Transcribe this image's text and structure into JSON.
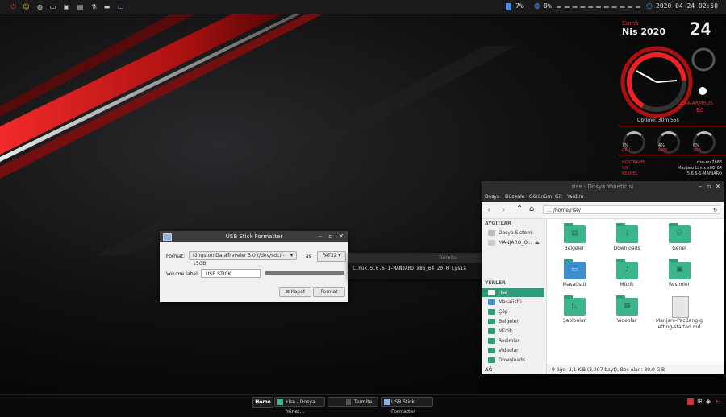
{
  "top_panel": {
    "cpu_percent": "7%",
    "mem_percent": "0%",
    "datetime": "2020-04-24 02:50",
    "launcher_icons": [
      "power-icon",
      "menu-icon",
      "browser-icon",
      "files-icon",
      "image-icon",
      "text-icon",
      "flask-icon",
      "chat-icon",
      "window-icon"
    ]
  },
  "conky": {
    "day": "Cuma",
    "month_year": "Nis 2020",
    "date": "24",
    "host_short": "LYSIA ARMHUS",
    "ampm": "BC",
    "uptime": "Uptime: 30m 55s",
    "gauges": [
      {
        "label": "CPU",
        "value": "7%"
      },
      {
        "label": "RAM",
        "value": "4%"
      },
      {
        "label": "SDA",
        "value": "0%"
      }
    ],
    "info_labels": [
      "HOSTNAME",
      "OS",
      "KERNEL"
    ],
    "info_values": [
      "rise-ms7b86",
      "Manjaro Linux x86_64",
      "5.6.6-1-MANJARO"
    ]
  },
  "usb_formatter": {
    "title": "USB Stick Formatter",
    "format_label": "Format:",
    "device": "Kingston DataTraveler 3.0 (/dev/sdc) - 15GB",
    "as_label": "as",
    "fs": "FAT32",
    "volume_label": "Volume label:",
    "volume_value": "USB STICK",
    "close_btn": "Kapat",
    "format_btn": "Format"
  },
  "terminal": {
    "title": "Termite",
    "line": "Linux 5.6.6-1-MANJARO x86_64 20.0 Lysia"
  },
  "file_manager": {
    "title": "rise - Dosya Yöneticisi",
    "menu": [
      "Dosya",
      "Düzenle",
      "Görünüm",
      "Git",
      "Yardım"
    ],
    "path": "/home/rise/",
    "sections": {
      "devices": "AYGITLAR",
      "places": "YERLER",
      "network": "AĞ"
    },
    "devices": [
      "Dosya Sistemi",
      "MANJARO_O..."
    ],
    "places": [
      "rise",
      "Masaüstü",
      "Çöp",
      "Belgeler",
      "Müzik",
      "Resimler",
      "Videolar",
      "Downloads"
    ],
    "items": [
      {
        "name": "Belgeler",
        "icon": "document-folder-icon"
      },
      {
        "name": "Downloads",
        "icon": "download-folder-icon"
      },
      {
        "name": "Genel",
        "icon": "public-folder-icon"
      },
      {
        "name": "Masaüstü",
        "icon": "desktop-folder-icon"
      },
      {
        "name": "Müzik",
        "icon": "music-folder-icon"
      },
      {
        "name": "Resimler",
        "icon": "pictures-folder-icon"
      },
      {
        "name": "Şablonlar",
        "icon": "templates-folder-icon"
      },
      {
        "name": "Videolar",
        "icon": "videos-folder-icon"
      },
      {
        "name": "Manjaro-PacBang-getting-started.md",
        "icon": "markdown-file-icon"
      }
    ],
    "status": "9 öğe: 3,1 KiB (3.207 bayt), Boş alan: 80,0 GiB"
  },
  "taskbar": {
    "home": "Home",
    "tasks": [
      "rise - Dosya Yönet...",
      "Termite",
      "USB Stick Formatter"
    ]
  },
  "colors": {
    "accent": "#cc2222",
    "folder": "#3cb48e",
    "panel": "#1a1a1a"
  }
}
